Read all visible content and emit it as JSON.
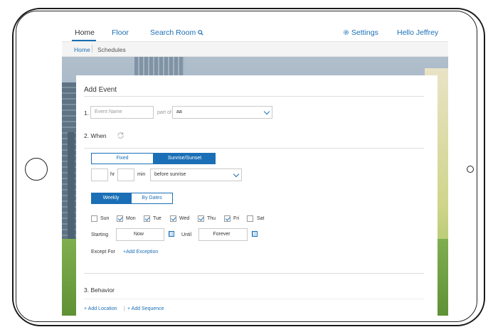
{
  "nav": {
    "home": "Home",
    "floor": "Floor",
    "search_room": "Search Room",
    "settings": "Settings",
    "greeting": "Hello Jeffrey"
  },
  "breadcrumb": {
    "home": "Home",
    "schedules": "Schedules"
  },
  "form": {
    "title": "Add Event",
    "step1_label": "1.",
    "event_name_placeholder": "Event Name",
    "part_of_label": "part of",
    "part_of_value": "aa",
    "step2_label": "2. When",
    "mode_tabs": [
      "Fixed",
      "Sunrise/Sunset"
    ],
    "mode_active": "Sunrise/Sunset",
    "hr_label": "hr",
    "min_label": "min",
    "offset_value": "before sunrise",
    "freq_tabs": [
      "Weekly",
      "By Dates"
    ],
    "freq_active": "Weekly",
    "days": [
      {
        "label": "Sun",
        "checked": false
      },
      {
        "label": "Mon",
        "checked": true
      },
      {
        "label": "Tue",
        "checked": true
      },
      {
        "label": "Wed",
        "checked": true
      },
      {
        "label": "Thu",
        "checked": true
      },
      {
        "label": "Fri",
        "checked": true
      },
      {
        "label": "Sat",
        "checked": false
      }
    ],
    "starting_label": "Starting",
    "starting_value": "Now",
    "until_label": "Until",
    "until_value": "Forever",
    "except_label": "Except For",
    "add_exception": "+Add Exception",
    "step3_label": "3. Behavior",
    "add_location": "+ Add Location",
    "add_sequence": "+ Add Sequence",
    "link_separator": "|"
  },
  "icons": {
    "search": "search-icon",
    "settings": "gear-icon",
    "refresh": "refresh-icon",
    "calendar": "calendar-icon"
  },
  "colors": {
    "accent": "#1a6fb6"
  }
}
